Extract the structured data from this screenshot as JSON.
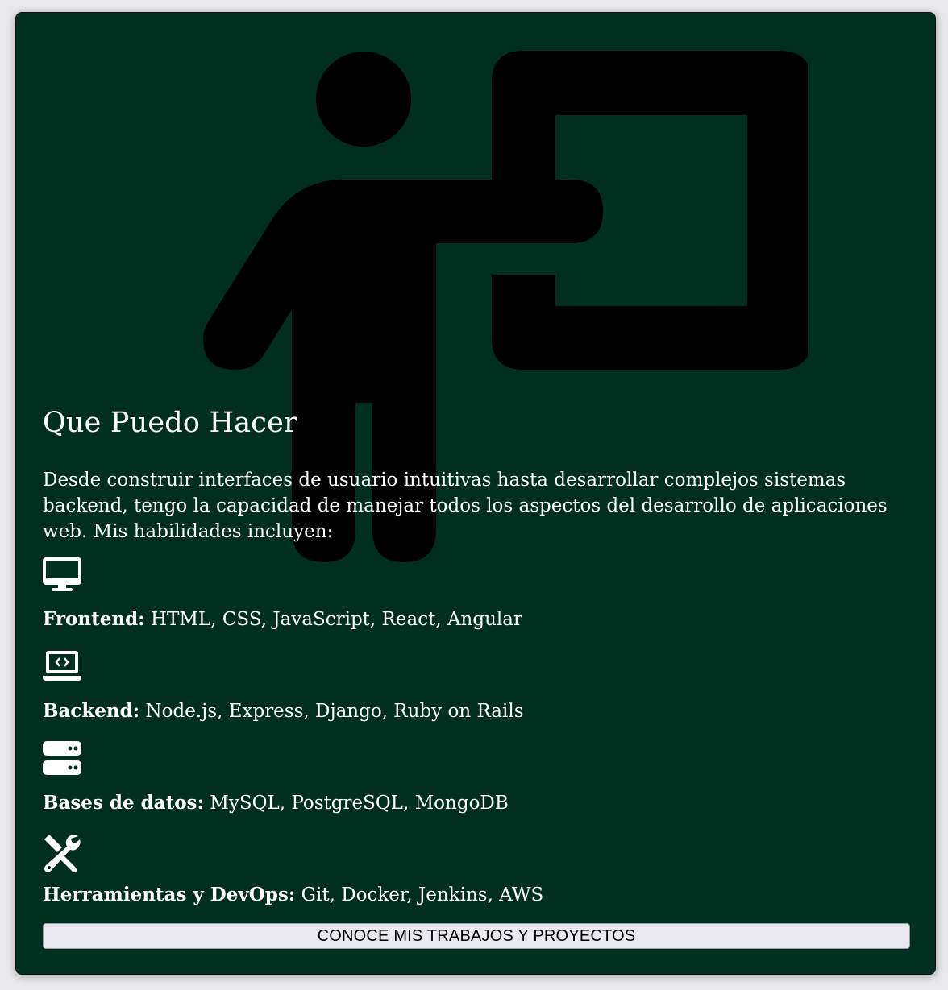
{
  "section": {
    "title": "Que Puedo Hacer",
    "intro": "Desde construir interfaces de usuario intuitivas hasta desarrollar complejos sistemas backend, tengo la capacidad de manejar todos los aspectos del desarrollo de aplicaciones web. Mis habilidades incluyen:"
  },
  "skills": [
    {
      "icon": "desktop-icon",
      "label": "Frontend:",
      "value": " HTML, CSS, JavaScript, React, Angular"
    },
    {
      "icon": "laptop-code-icon",
      "label": "Backend:",
      "value": " Node.js, Express, Django, Ruby on Rails"
    },
    {
      "icon": "server-icon",
      "label": "Bases de datos:",
      "value": " MySQL, PostgreSQL, MongoDB"
    },
    {
      "icon": "tools-icon",
      "label": "Herramientas y DevOps:",
      "value": " Git, Docker, Jenkins, AWS"
    }
  ],
  "cta": {
    "label": "CONOCE MIS TRABAJOS Y PROYECTOS"
  },
  "colors": {
    "card_background": "#002e1f",
    "text": "#ffffff",
    "illustration": "#000000",
    "button_background": "#e8e8ee"
  }
}
